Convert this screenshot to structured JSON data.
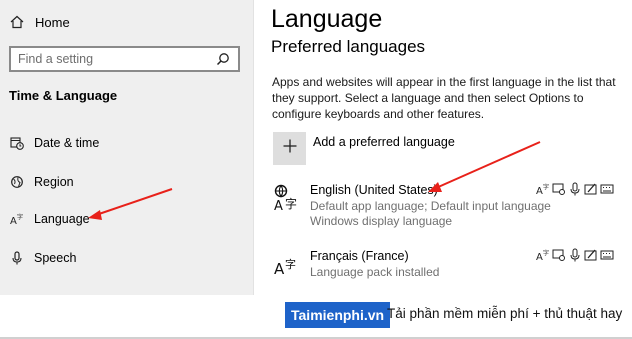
{
  "sidebar": {
    "home_label": "Home",
    "search_placeholder": "Find a setting",
    "section_title": "Time & Language",
    "items": [
      {
        "label": "Date & time",
        "icon": "calendar-clock-icon"
      },
      {
        "label": "Region",
        "icon": "globe-icon"
      },
      {
        "label": "Language",
        "icon": "language-icon"
      },
      {
        "label": "Speech",
        "icon": "microphone-icon"
      }
    ]
  },
  "main": {
    "title": "Language",
    "subtitle": "Preferred languages",
    "description": "Apps and websites will appear in the first language in the list that they support. Select a language and then select Options to configure keyboards and other features.",
    "add_label": "Add a preferred language",
    "languages": [
      {
        "name": "English (United States)",
        "details": [
          "Default app language; Default input language",
          "Windows display language"
        ]
      },
      {
        "name": "Français (France)",
        "details": [
          "Language pack installed"
        ]
      }
    ]
  },
  "watermark": {
    "brand": "Taimienphi.vn",
    "tagline": "Tải phần mềm miễn phí + thủ thuật hay"
  },
  "colors": {
    "sidebar_bg": "#efefef",
    "arrow": "#e8211a",
    "brand_bg": "#1e63c9"
  }
}
